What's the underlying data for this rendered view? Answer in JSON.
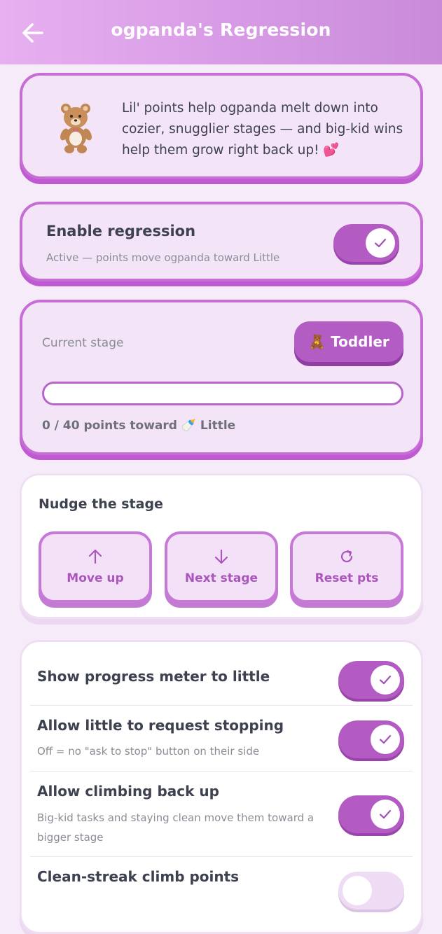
{
  "header": {
    "title": "ogpanda's Regression",
    "back_icon": "arrow-left-icon"
  },
  "intro": {
    "icon": "teddy-bear-icon",
    "text": "Lil' points help ogpanda melt down into cozier, snugglier stages — and big-kid wins help them grow right back up! 💕"
  },
  "enable": {
    "title": "Enable regression",
    "description": "Active — points move ogpanda toward Little",
    "enabled": true
  },
  "stage": {
    "label": "Current stage",
    "current": "🧸 Toddler",
    "progress_text": "0 / 40 points toward 🍼 Little",
    "points": 0,
    "points_target": 40
  },
  "nudge": {
    "title": "Nudge the stage",
    "buttons": [
      {
        "icon": "arrow-up-icon",
        "label": "Move up"
      },
      {
        "icon": "arrow-down-icon",
        "label": "Next stage"
      },
      {
        "icon": "refresh-icon",
        "label": "Reset pts"
      }
    ]
  },
  "settings": [
    {
      "title": "Show progress meter to little",
      "description": "",
      "enabled": true
    },
    {
      "title": "Allow little to request stopping",
      "description": "Off = no \"ask to stop\" button on their side",
      "enabled": true
    },
    {
      "title": "Allow climbing back up",
      "description": "Big-kid tasks and staying clean move them toward a bigger stage",
      "enabled": true
    },
    {
      "title": "Clean-streak climb points",
      "description": "",
      "enabled": false
    }
  ],
  "colors": {
    "header_gradient_start": "#e7b0f0",
    "header_gradient_end": "#c98bd9",
    "accent": "#b35ac3",
    "card_border": "#c66dd6",
    "background": "#f6ecf9"
  }
}
